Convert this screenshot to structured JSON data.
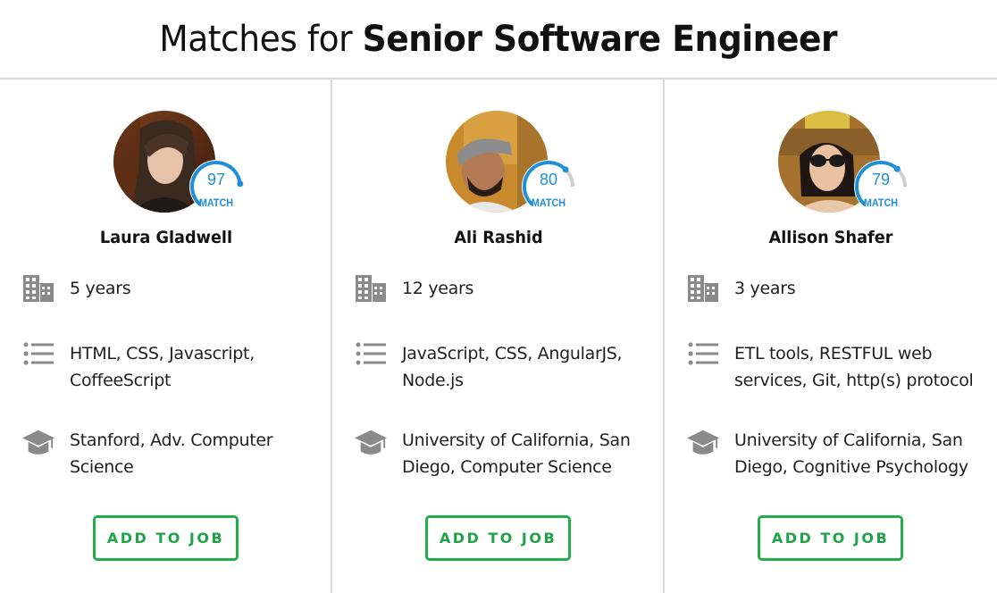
{
  "header": {
    "title_prefix": "Matches for ",
    "job_title": "Senior Software Engineer"
  },
  "colors": {
    "match_ring": "#1f8fd6",
    "match_track": "#cfcfcf",
    "button_green": "#1fae4a",
    "icon_gray": "#8a8a8a"
  },
  "candidates": [
    {
      "name": "Laura Gladwell",
      "match_score": "97",
      "match_fraction": 0.97,
      "match_label": "MATCH",
      "experience": "5 years",
      "skills": "HTML, CSS, Javascript, CoffeeScript",
      "education": "Stanford, Adv. Computer Science",
      "button_label": "ADD TO JOB"
    },
    {
      "name": "Ali Rashid",
      "match_score": "80",
      "match_fraction": 0.8,
      "match_label": "MATCH",
      "experience": "12 years",
      "skills": "JavaScript, CSS, AngularJS, Node.js",
      "education": "University of California, San Diego, Computer Science",
      "button_label": "ADD TO JOB"
    },
    {
      "name": "Allison Shafer",
      "match_score": "79",
      "match_fraction": 0.79,
      "match_label": "MATCH",
      "experience": "3 years",
      "skills": "ETL tools, RESTFUL web services, Git, http(s) protocol",
      "education": "University of California, San Diego, Cognitive Psychology",
      "button_label": "ADD TO JOB"
    }
  ]
}
